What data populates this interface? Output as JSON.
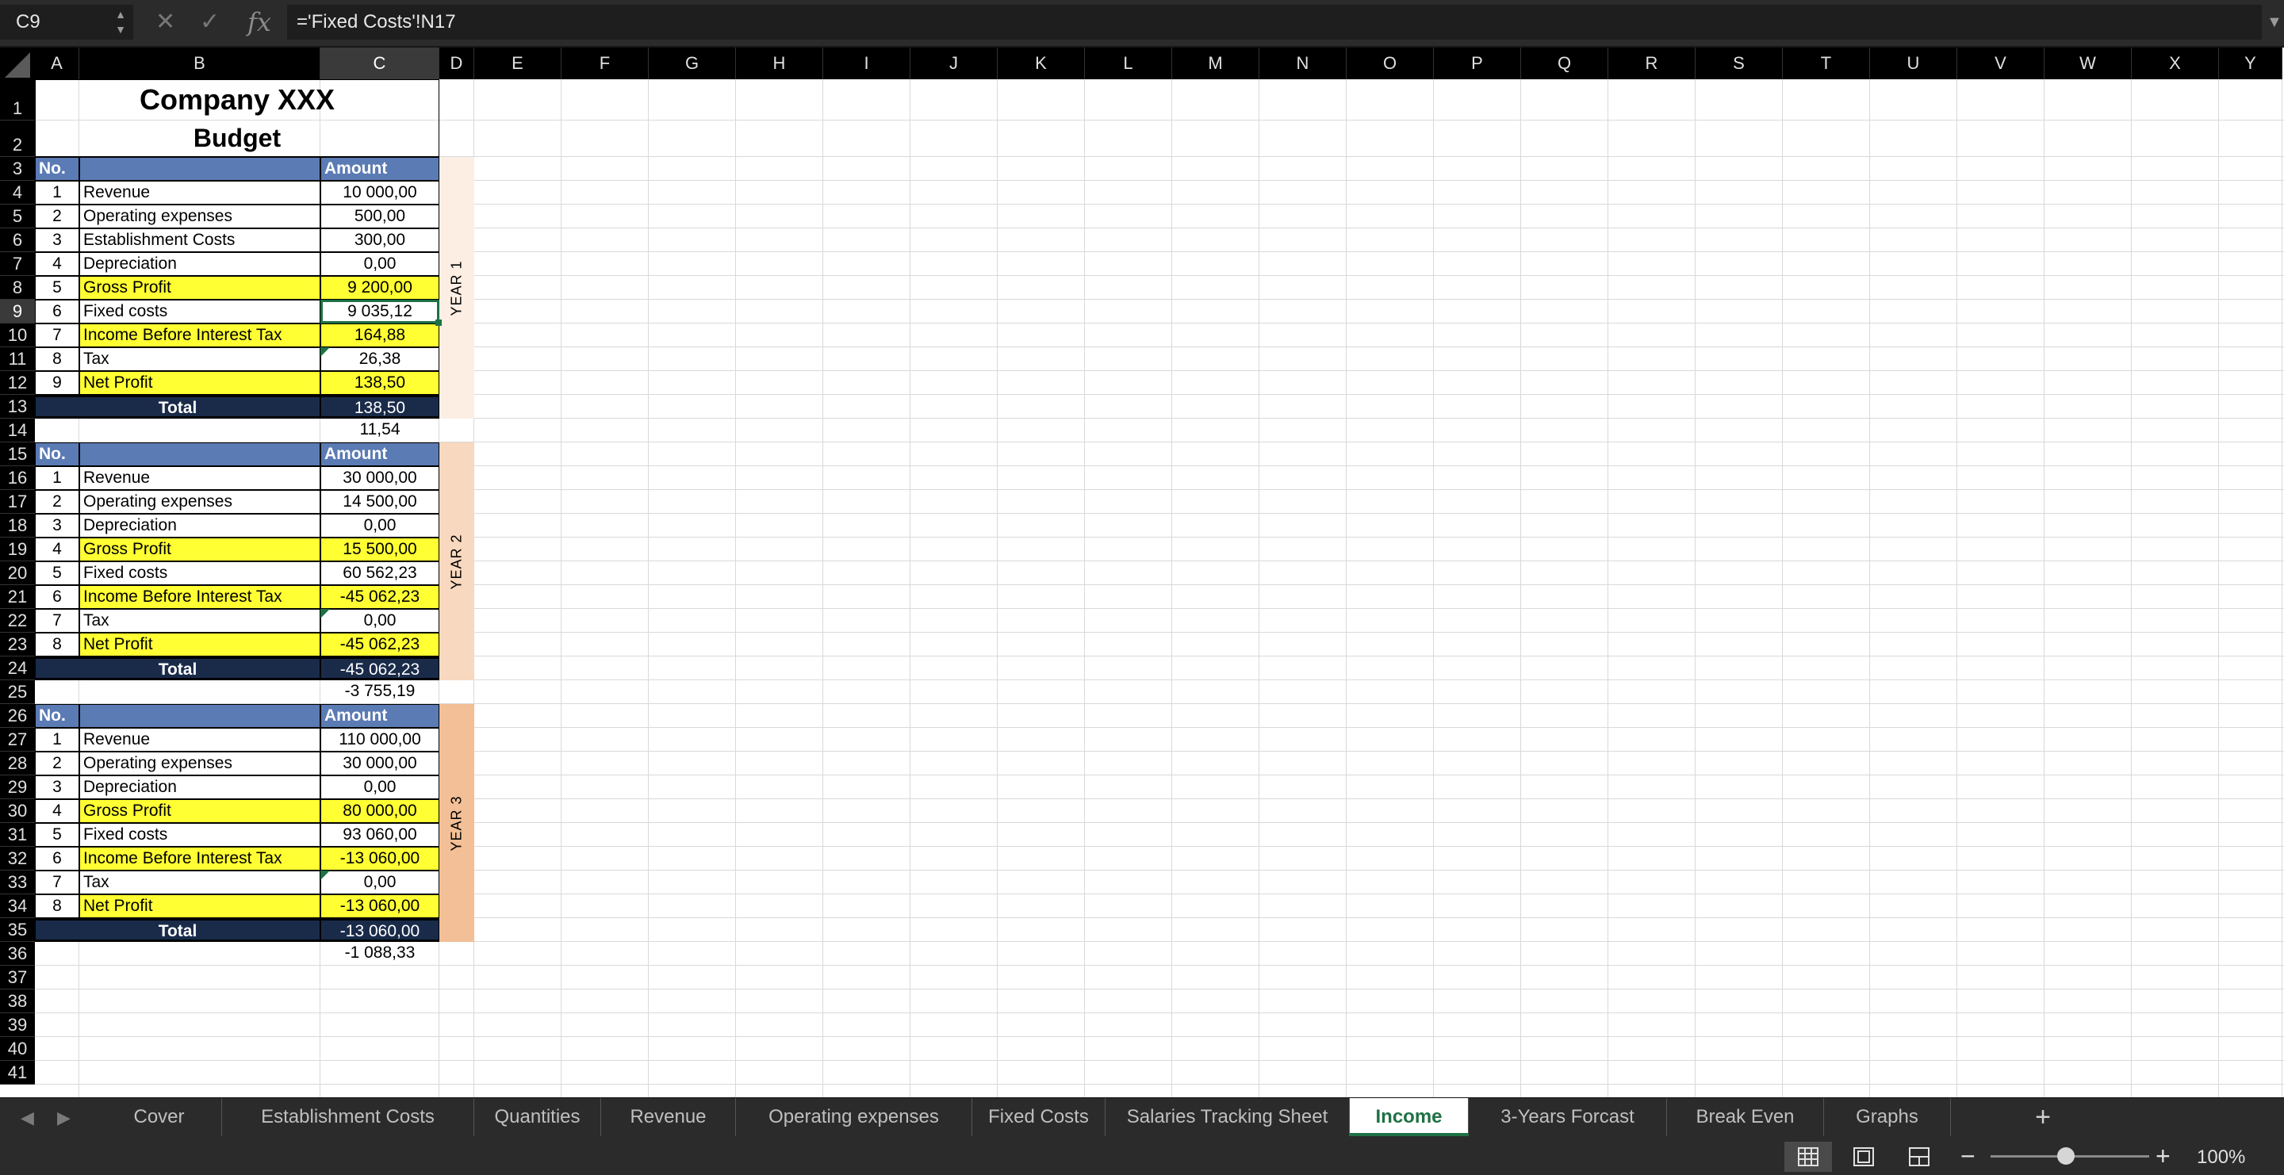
{
  "formula_bar": {
    "cell_ref": "C9",
    "formula": "='Fixed Costs'!N17"
  },
  "columns": [
    "A",
    "B",
    "C",
    "D",
    "E",
    "F",
    "G",
    "H",
    "I",
    "J",
    "K",
    "L",
    "M",
    "N",
    "O",
    "P",
    "Q",
    "R",
    "S",
    "T",
    "U",
    "V",
    "W",
    "X",
    "Y"
  ],
  "rows": [
    "1",
    "2",
    "3",
    "4",
    "5",
    "6",
    "7",
    "8",
    "9",
    "10",
    "11",
    "12",
    "13",
    "14",
    "15",
    "16",
    "17",
    "18",
    "19",
    "20",
    "21",
    "22",
    "23",
    "24",
    "25",
    "26",
    "27",
    "28",
    "29",
    "30",
    "31",
    "32",
    "33",
    "34",
    "35",
    "36",
    "37",
    "38",
    "39",
    "40",
    "41"
  ],
  "selected_cell": {
    "column": "C",
    "row": "9"
  },
  "title": "Company XXX",
  "subtitle": "Budget",
  "headers": {
    "no": "No.",
    "amount": "Amount",
    "total": "Total"
  },
  "years": [
    {
      "label": "YEAR 1",
      "color": "#fdeee4",
      "items": [
        {
          "no": "1",
          "label": "Revenue",
          "amount": "10 000,00",
          "highlight": false
        },
        {
          "no": "2",
          "label": "Operating expenses",
          "amount": "500,00",
          "highlight": false
        },
        {
          "no": "3",
          "label": "Establishment Costs",
          "amount": "300,00",
          "highlight": false
        },
        {
          "no": "4",
          "label": "Depreciation",
          "amount": "0,00",
          "highlight": false
        },
        {
          "no": "5",
          "label": "Gross Profit",
          "amount": "9 200,00",
          "highlight": true
        },
        {
          "no": "6",
          "label": "Fixed costs",
          "amount": "9 035,12",
          "highlight": false
        },
        {
          "no": "7",
          "label": "Income Before Interest Tax",
          "amount": "164,88",
          "highlight": true
        },
        {
          "no": "8",
          "label": "Tax",
          "amount": "26,38",
          "highlight": false
        },
        {
          "no": "9",
          "label": "Net Profit",
          "amount": "138,50",
          "highlight": true
        }
      ],
      "total": "138,50",
      "monthly": "11,54"
    },
    {
      "label": "YEAR 2",
      "color": "#f8d8be",
      "items": [
        {
          "no": "1",
          "label": "Revenue",
          "amount": "30 000,00",
          "highlight": false
        },
        {
          "no": "2",
          "label": "Operating expenses",
          "amount": "14 500,00",
          "highlight": false
        },
        {
          "no": "3",
          "label": "Depreciation",
          "amount": "0,00",
          "highlight": false
        },
        {
          "no": "4",
          "label": "Gross Profit",
          "amount": "15 500,00",
          "highlight": true
        },
        {
          "no": "5",
          "label": "Fixed costs",
          "amount": "60 562,23",
          "highlight": false
        },
        {
          "no": "6",
          "label": "Income Before Interest Tax",
          "amount": "-45 062,23",
          "highlight": true
        },
        {
          "no": "7",
          "label": "Tax",
          "amount": "0,00",
          "highlight": false
        },
        {
          "no": "8",
          "label": "Net Profit",
          "amount": "-45 062,23",
          "highlight": true
        }
      ],
      "total": "-45 062,23",
      "monthly": "-3 755,19"
    },
    {
      "label": "YEAR 3",
      "color": "#f2bf96",
      "items": [
        {
          "no": "1",
          "label": "Revenue",
          "amount": "110 000,00",
          "highlight": false
        },
        {
          "no": "2",
          "label": "Operating expenses",
          "amount": "30 000,00",
          "highlight": false
        },
        {
          "no": "3",
          "label": "Depreciation",
          "amount": "0,00",
          "highlight": false
        },
        {
          "no": "4",
          "label": "Gross Profit",
          "amount": "80 000,00",
          "highlight": true
        },
        {
          "no": "5",
          "label": "Fixed costs",
          "amount": "93 060,00",
          "highlight": false
        },
        {
          "no": "6",
          "label": "Income Before Interest Tax",
          "amount": "-13 060,00",
          "highlight": true
        },
        {
          "no": "7",
          "label": "Tax",
          "amount": "0,00",
          "highlight": false
        },
        {
          "no": "8",
          "label": "Net Profit",
          "amount": "-13 060,00",
          "highlight": true
        }
      ],
      "total": "-13 060,00",
      "monthly": "-1 088,33"
    }
  ],
  "sheet_tabs": [
    "Cover",
    "Establishment  Costs",
    "Quantities",
    "Revenue",
    "Operating expenses",
    "Fixed Costs",
    "Salaries Tracking Sheet",
    "Income",
    "3-Years Forcast",
    "Break Even",
    "Graphs"
  ],
  "active_tab": "Income",
  "zoom": "100%",
  "colors": {
    "header_blue": "#5b7bb4",
    "highlight_yellow": "#ffff33",
    "total_navy": "#1a2b4a",
    "accent_green": "#1e7145"
  }
}
